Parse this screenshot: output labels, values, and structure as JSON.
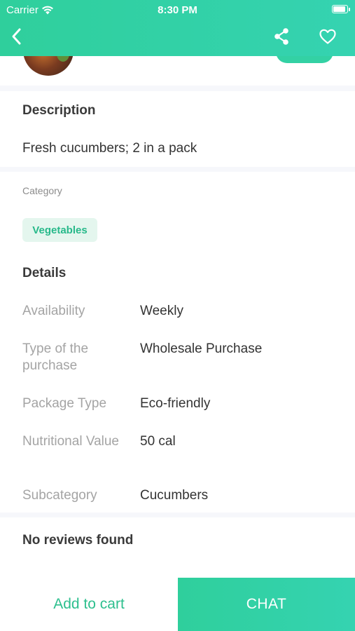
{
  "status": {
    "carrier": "Carrier",
    "time": "8:30 PM"
  },
  "nav": {
    "back_icon": "back-chevron-icon",
    "share_icon": "share-icon",
    "favorite_icon": "heart-icon"
  },
  "description": {
    "title": "Description",
    "text": "Fresh cucumbers; 2 in a pack"
  },
  "category": {
    "label": "Category",
    "tag": "Vegetables"
  },
  "details": {
    "title": "Details",
    "rows": [
      {
        "key": "Availability",
        "value": "Weekly"
      },
      {
        "key": "Type of the purchase",
        "value": "Wholesale Purchase"
      },
      {
        "key": "Package Type",
        "value": "Eco-friendly"
      },
      {
        "key": "Nutritional Value",
        "value": "50 cal"
      },
      {
        "key": "Subcategory",
        "value": "Cucumbers"
      }
    ]
  },
  "reviews": {
    "empty_text": "No reviews found"
  },
  "actions": {
    "add_to_cart": "Add to cart",
    "chat": "CHAT"
  },
  "colors": {
    "accent": "#2fcf9c",
    "tag_bg": "#e4f6ee",
    "tag_text": "#27b98a"
  }
}
